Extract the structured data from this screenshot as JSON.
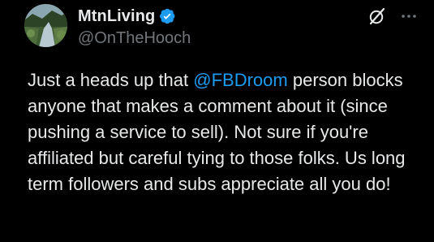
{
  "author": {
    "display_name": "MtnLiving",
    "handle": "@OnTheHooch",
    "verified": true
  },
  "post": {
    "text_before_mention": "Just a heads up that ",
    "mention": "@FBDroom",
    "text_after_mention": " person blocks anyone that makes a comment about it (since pushing a service to sell).  Not sure if you're affiliated but careful tying to those folks.  Us long term followers and subs appreciate all you do!"
  },
  "icons": {
    "avatar": "avatar",
    "verified": "verified-badge-icon",
    "grok": "grok-icon",
    "more": "more-icon"
  },
  "colors": {
    "background": "#000000",
    "text": "#e7e9ea",
    "secondary": "#71767b",
    "accent": "#1d9bf0"
  }
}
